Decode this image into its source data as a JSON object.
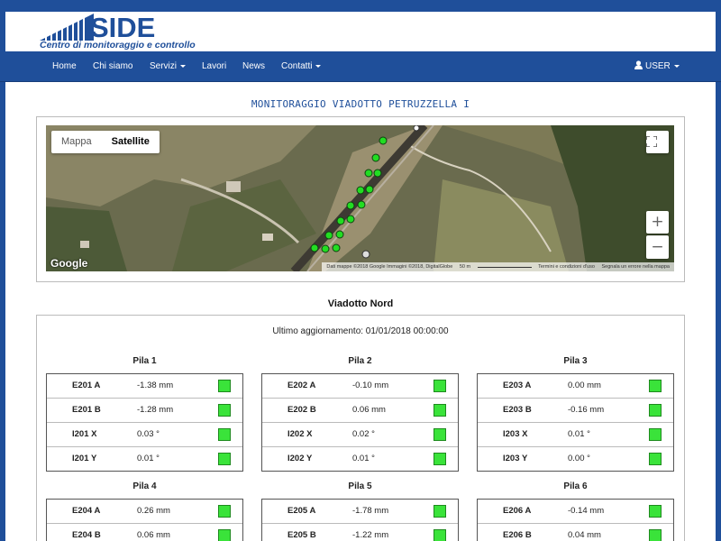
{
  "brand": {
    "name": "SIDE",
    "subtitle": "Centro di monitoraggio e controllo"
  },
  "nav": {
    "items": [
      {
        "label": "Home"
      },
      {
        "label": "Chi siamo"
      },
      {
        "label": "Servizi",
        "dropdown": true
      },
      {
        "label": "Lavori"
      },
      {
        "label": "News"
      },
      {
        "label": "Contatti",
        "dropdown": true
      }
    ],
    "user": {
      "label": "USER",
      "icon": "user-icon"
    }
  },
  "page": {
    "title": "MONITORAGGIO VIADOTTO PETRUZZELLA I"
  },
  "map": {
    "type_buttons": {
      "map": "Mappa",
      "satellite": "Satellite",
      "selected": "Satellite"
    },
    "controls": {
      "fullscreen": "fullscreen-icon",
      "zoom_in": "+",
      "zoom_out": "−"
    },
    "logo": "Google",
    "attribution": {
      "data": "Dati mappe ©2018 Google Immagini ©2018, DigitalGlobe",
      "scale": "50 m",
      "terms": "Termini e condizioni d'uso",
      "report": "Segnala un errore nella mappa"
    },
    "marker_color_ok": "#22dd22",
    "marker_color_off": "#dddddd"
  },
  "section": {
    "title": "Viadotto Nord",
    "last_update": "Ultimo aggiornamento: 01/01/2018 00:00:00"
  },
  "status_colors": {
    "ok": "#3ae33a"
  },
  "piles": [
    {
      "title": "Pila 1",
      "rows": [
        {
          "code": "E201 A",
          "value": "-1.38 mm",
          "status": "ok"
        },
        {
          "code": "E201 B",
          "value": "-1.28 mm",
          "status": "ok"
        },
        {
          "code": "I201 X",
          "value": "0.03 °",
          "status": "ok"
        },
        {
          "code": "I201 Y",
          "value": "0.01 °",
          "status": "ok"
        }
      ]
    },
    {
      "title": "Pila 2",
      "rows": [
        {
          "code": "E202 A",
          "value": "-0.10 mm",
          "status": "ok"
        },
        {
          "code": "E202 B",
          "value": "0.06 mm",
          "status": "ok"
        },
        {
          "code": "I202 X",
          "value": "0.02 °",
          "status": "ok"
        },
        {
          "code": "I202 Y",
          "value": "0.01 °",
          "status": "ok"
        }
      ]
    },
    {
      "title": "Pila 3",
      "rows": [
        {
          "code": "E203 A",
          "value": "0.00 mm",
          "status": "ok"
        },
        {
          "code": "E203 B",
          "value": "-0.16 mm",
          "status": "ok"
        },
        {
          "code": "I203 X",
          "value": "0.01 °",
          "status": "ok"
        },
        {
          "code": "I203 Y",
          "value": "0.00 °",
          "status": "ok"
        }
      ]
    },
    {
      "title": "Pila 4",
      "rows": [
        {
          "code": "E204 A",
          "value": "0.26 mm",
          "status": "ok"
        },
        {
          "code": "E204 B",
          "value": "0.06 mm",
          "status": "ok"
        }
      ]
    },
    {
      "title": "Pila 5",
      "rows": [
        {
          "code": "E205 A",
          "value": "-1.78 mm",
          "status": "ok"
        },
        {
          "code": "E205 B",
          "value": "-1.22 mm",
          "status": "ok"
        }
      ]
    },
    {
      "title": "Pila 6",
      "rows": [
        {
          "code": "E206 A",
          "value": "-0.14 mm",
          "status": "ok"
        },
        {
          "code": "E206 B",
          "value": "0.04 mm",
          "status": "ok"
        }
      ]
    }
  ]
}
